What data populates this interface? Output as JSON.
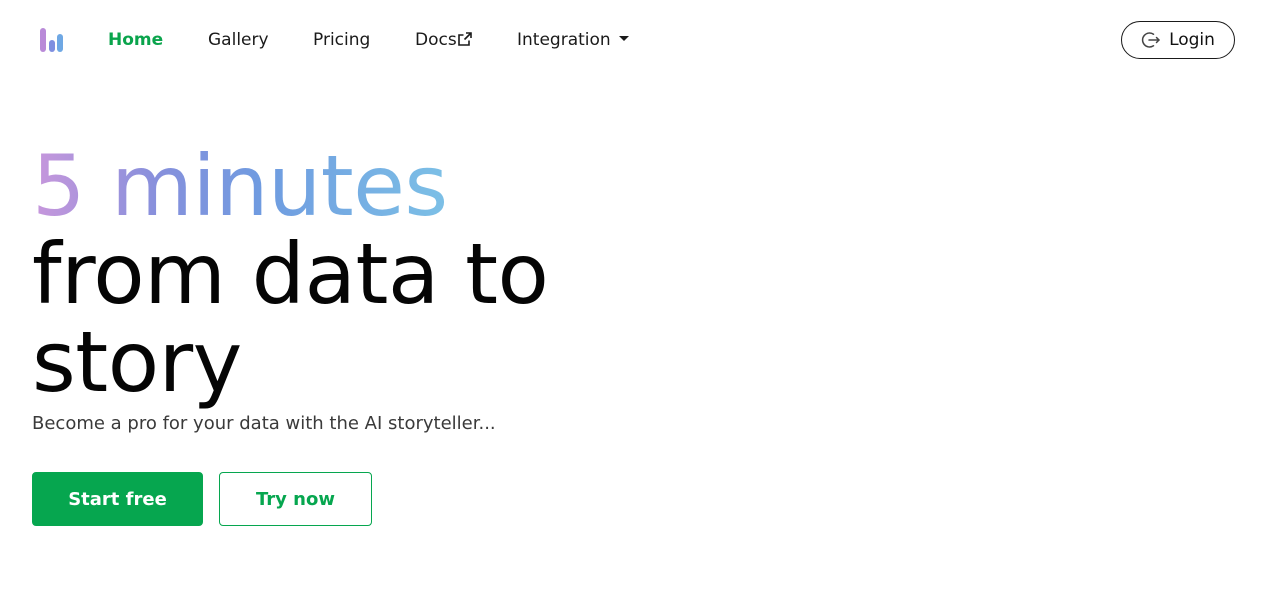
{
  "nav": {
    "logo_icon": "bar-chart-logo-icon",
    "items": [
      {
        "label": "Home",
        "active": true
      },
      {
        "label": "Gallery"
      },
      {
        "label": "Pricing"
      },
      {
        "label": "Docs",
        "icon": "external-link-icon"
      },
      {
        "label": "Integration",
        "icon": "caret-down-icon"
      }
    ],
    "login": {
      "label": "Login",
      "icon": "login-icon"
    }
  },
  "hero": {
    "line1": "5 minutes",
    "line2": "from data to",
    "line3": "story",
    "subtitle": "Become a pro for your data with the AI storyteller..."
  },
  "cta": {
    "primary": "Start free",
    "secondary": "Try now"
  },
  "colors": {
    "accent_green": "#06a64f",
    "gradient": [
      "#c897dc",
      "#8790dc",
      "#6f9be0",
      "#7cc0e6"
    ]
  }
}
